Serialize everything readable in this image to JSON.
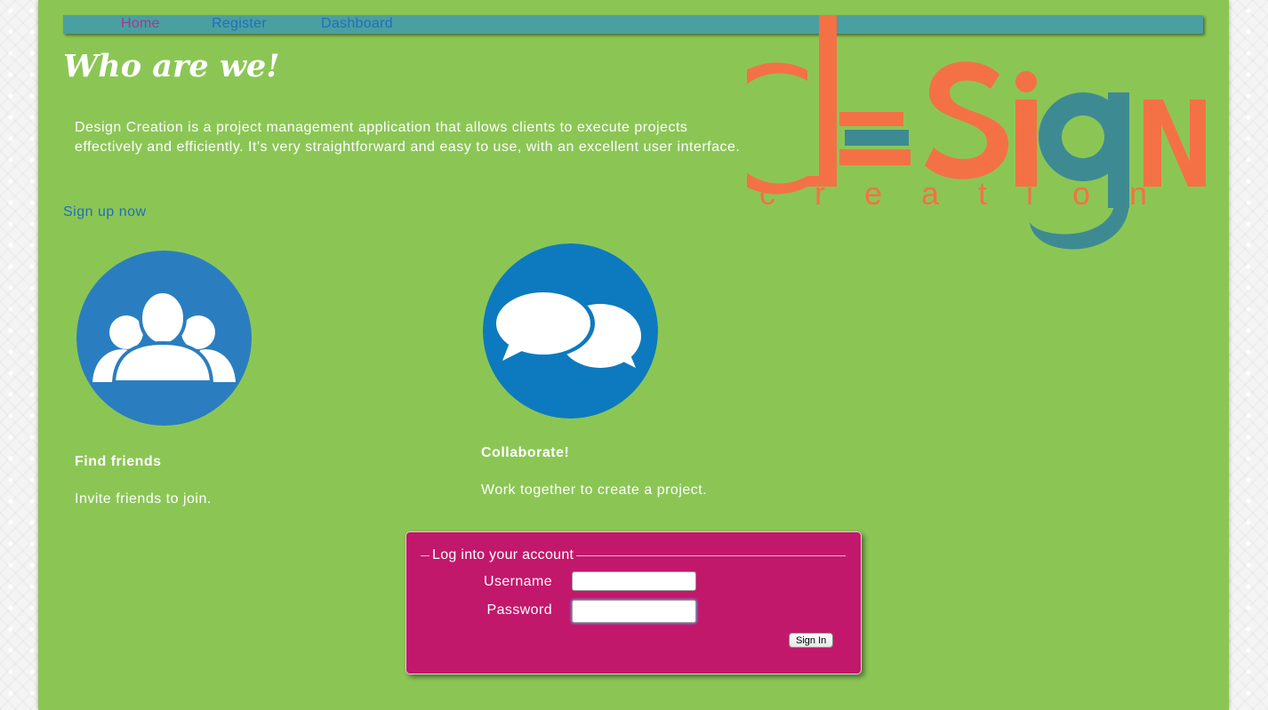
{
  "nav": {
    "items": [
      {
        "label": "Home",
        "active": true
      },
      {
        "label": "Register",
        "active": false
      },
      {
        "label": "Dashboard",
        "active": false
      }
    ]
  },
  "intro": {
    "heading": "Who are we!",
    "text": "Design Creation is a project management application that allows clients to execute projects effectively and efficiently. It's very straightforward and easy to use, with an excellent user interface.",
    "signup_link": "Sign up now"
  },
  "logo": {
    "word_top": "dESign",
    "word_bottom": "creation",
    "colors": {
      "orange": "#f47146",
      "teal": "#3e8a93"
    }
  },
  "features": [
    {
      "icon": "people-group-icon",
      "title": "Find friends",
      "description": "Invite friends to join.",
      "color": "#2a7ec0"
    },
    {
      "icon": "speech-bubbles-icon",
      "title": "Collaborate!",
      "description": "Work together to create a project.",
      "color": "#0d7abf"
    }
  ],
  "login": {
    "legend": "Log into your account",
    "username_label": "Username",
    "password_label": "Password",
    "username_value": "",
    "password_value": "",
    "submit_label": "Sign In"
  },
  "colors": {
    "page_bg": "#8bc655",
    "nav_bg": "#4a9fa1",
    "link": "#1f6fc0",
    "active_link": "#a23b8f",
    "login_bg": "#c2186b"
  }
}
